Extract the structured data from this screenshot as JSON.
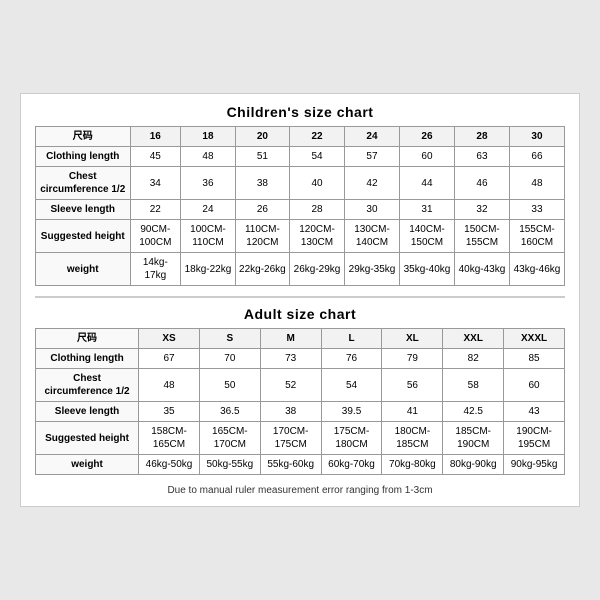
{
  "children_chart": {
    "title": "Children's size chart",
    "headers": [
      "尺码",
      "16",
      "18",
      "20",
      "22",
      "24",
      "26",
      "28",
      "30"
    ],
    "rows": [
      {
        "label": "Clothing length",
        "values": [
          "45",
          "48",
          "51",
          "54",
          "57",
          "60",
          "63",
          "66"
        ]
      },
      {
        "label": "Chest circumference 1/2",
        "values": [
          "34",
          "36",
          "38",
          "40",
          "42",
          "44",
          "46",
          "48"
        ]
      },
      {
        "label": "Sleeve length",
        "values": [
          "22",
          "24",
          "26",
          "28",
          "30",
          "31",
          "32",
          "33"
        ]
      },
      {
        "label": "Suggested height",
        "values": [
          "90CM-100CM",
          "100CM-110CM",
          "110CM-120CM",
          "120CM-130CM",
          "130CM-140CM",
          "140CM-150CM",
          "150CM-155CM",
          "155CM-160CM"
        ]
      },
      {
        "label": "weight",
        "values": [
          "14kg-17kg",
          "18kg-22kg",
          "22kg-26kg",
          "26kg-29kg",
          "29kg-35kg",
          "35kg-40kg",
          "40kg-43kg",
          "43kg-46kg"
        ]
      }
    ]
  },
  "adult_chart": {
    "title": "Adult size chart",
    "headers": [
      "尺码",
      "XS",
      "S",
      "M",
      "L",
      "XL",
      "XXL",
      "XXXL"
    ],
    "rows": [
      {
        "label": "Clothing length",
        "values": [
          "67",
          "70",
          "73",
          "76",
          "79",
          "82",
          "85"
        ]
      },
      {
        "label": "Chest circumference 1/2",
        "values": [
          "48",
          "50",
          "52",
          "54",
          "56",
          "58",
          "60"
        ]
      },
      {
        "label": "Sleeve length",
        "values": [
          "35",
          "36.5",
          "38",
          "39.5",
          "41",
          "42.5",
          "43"
        ]
      },
      {
        "label": "Suggested height",
        "values": [
          "158CM-165CM",
          "165CM-170CM",
          "170CM-175CM",
          "175CM-180CM",
          "180CM-185CM",
          "185CM-190CM",
          "190CM-195CM"
        ]
      },
      {
        "label": "weight",
        "values": [
          "46kg-50kg",
          "50kg-55kg",
          "55kg-60kg",
          "60kg-70kg",
          "70kg-80kg",
          "80kg-90kg",
          "90kg-95kg"
        ]
      }
    ]
  },
  "note": "Due to manual ruler measurement error ranging from 1-3cm"
}
